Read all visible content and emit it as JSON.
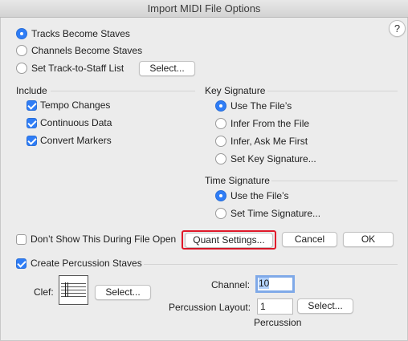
{
  "window": {
    "title": "Import MIDI File Options",
    "help_label": "?"
  },
  "tracks": {
    "options": [
      {
        "label": "Tracks Become Staves",
        "selected": true
      },
      {
        "label": "Channels Become Staves",
        "selected": false
      },
      {
        "label": "Set Track-to-Staff List",
        "selected": false
      }
    ],
    "select_label": "Select..."
  },
  "include": {
    "heading": "Include",
    "items": [
      {
        "label": "Tempo Changes",
        "checked": true
      },
      {
        "label": "Continuous Data",
        "checked": true
      },
      {
        "label": "Convert Markers",
        "checked": true
      }
    ]
  },
  "key_signature": {
    "heading": "Key Signature",
    "options": [
      {
        "label": "Use The File’s",
        "selected": true
      },
      {
        "label": "Infer From the File",
        "selected": false
      },
      {
        "label": "Infer, Ask Me First",
        "selected": false
      },
      {
        "label": "Set Key Signature...",
        "selected": false
      }
    ]
  },
  "time_signature": {
    "heading": "Time Signature",
    "options": [
      {
        "label": "Use the File’s",
        "selected": true
      },
      {
        "label": "Set Time Signature...",
        "selected": false
      }
    ]
  },
  "footer": {
    "dont_show_label": "Don’t Show This During File Open",
    "dont_show_checked": false,
    "quant_label": "Quant Settings...",
    "cancel_label": "Cancel",
    "ok_label": "OK"
  },
  "percussion": {
    "create_label": "Create Percussion Staves",
    "create_checked": true,
    "clef_label": "Clef:",
    "clef_select_label": "Select...",
    "channel_label": "Channel:",
    "channel_value": "10",
    "layout_label": "Percussion Layout:",
    "layout_value": "1",
    "layout_select_label": "Select...",
    "layout_name": "Percussion"
  },
  "colors": {
    "accent": "#2f7df6",
    "highlight": "#e0192a"
  }
}
